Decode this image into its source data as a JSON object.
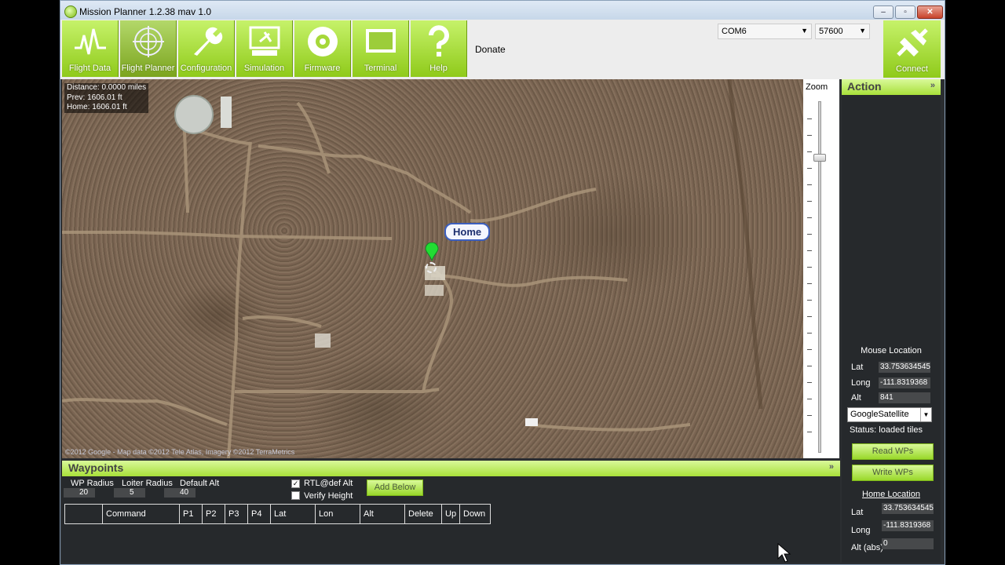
{
  "window": {
    "title": "Mission Planner 1.2.38 mav 1.0",
    "min": "–",
    "max": "▫",
    "close": "✕"
  },
  "toolbar": {
    "buttons": [
      {
        "label": "Flight Data",
        "icon": "flight-data-icon"
      },
      {
        "label": "Flight Planner",
        "icon": "flight-planner-icon",
        "active": true
      },
      {
        "label": "Configuration",
        "icon": "wrench-icon"
      },
      {
        "label": "Simulation",
        "icon": "simulation-icon"
      },
      {
        "label": "Firmware",
        "icon": "disc-icon"
      },
      {
        "label": "Terminal",
        "icon": "terminal-icon"
      },
      {
        "label": "Help",
        "icon": "question-icon"
      }
    ],
    "donate": "Donate",
    "port": "COM6",
    "baud": "57600",
    "connect": "Connect"
  },
  "map": {
    "info": {
      "distance": "Distance: 0.0000 miles",
      "prev": "Prev: 1606.01 ft",
      "home": "Home: 1606.01 ft"
    },
    "home_label": "Home",
    "copyright": "©2012 Google - Map data ©2012 Tele Atlas, Imagery ©2012 TerraMetrics",
    "zoom_label": "Zoom",
    "zoom_level_fraction": 0.84
  },
  "action": {
    "title": "Action",
    "mouse_location_title": "Mouse Location",
    "lat_label": "Lat",
    "lat": "33.753634545",
    "long_label": "Long",
    "long": "-111.8319368",
    "alt_label": "Alt",
    "alt": "841",
    "map_type": "GoogleSatellite",
    "status": "Status: loaded tiles",
    "read_wps": "Read WPs",
    "write_wps": "Write WPs",
    "home_location_title": "Home Location",
    "home_lat_label": "Lat",
    "home_lat": "33.753634545",
    "home_long_label": "Long",
    "home_long": "-111.8319368",
    "home_alt_label": "Alt (abs)",
    "home_alt": "0"
  },
  "waypoints": {
    "title": "Waypoints",
    "wp_radius_label": "WP Radius",
    "wp_radius": "20",
    "loiter_radius_label": "Loiter Radius",
    "loiter_radius": "5",
    "default_alt_label": "Default Alt",
    "default_alt": "40",
    "rtl_label": "RTL@def Alt",
    "rtl_checked": "✓",
    "verify_label": "Verify Height",
    "add_below": "Add Below",
    "columns": [
      "",
      "Command",
      "P1",
      "P2",
      "P3",
      "P4",
      "Lat",
      "Lon",
      "Alt",
      "Delete",
      "Up",
      "Down"
    ]
  },
  "colors": {
    "accent": "#a8e03a",
    "panel": "#26292c"
  }
}
